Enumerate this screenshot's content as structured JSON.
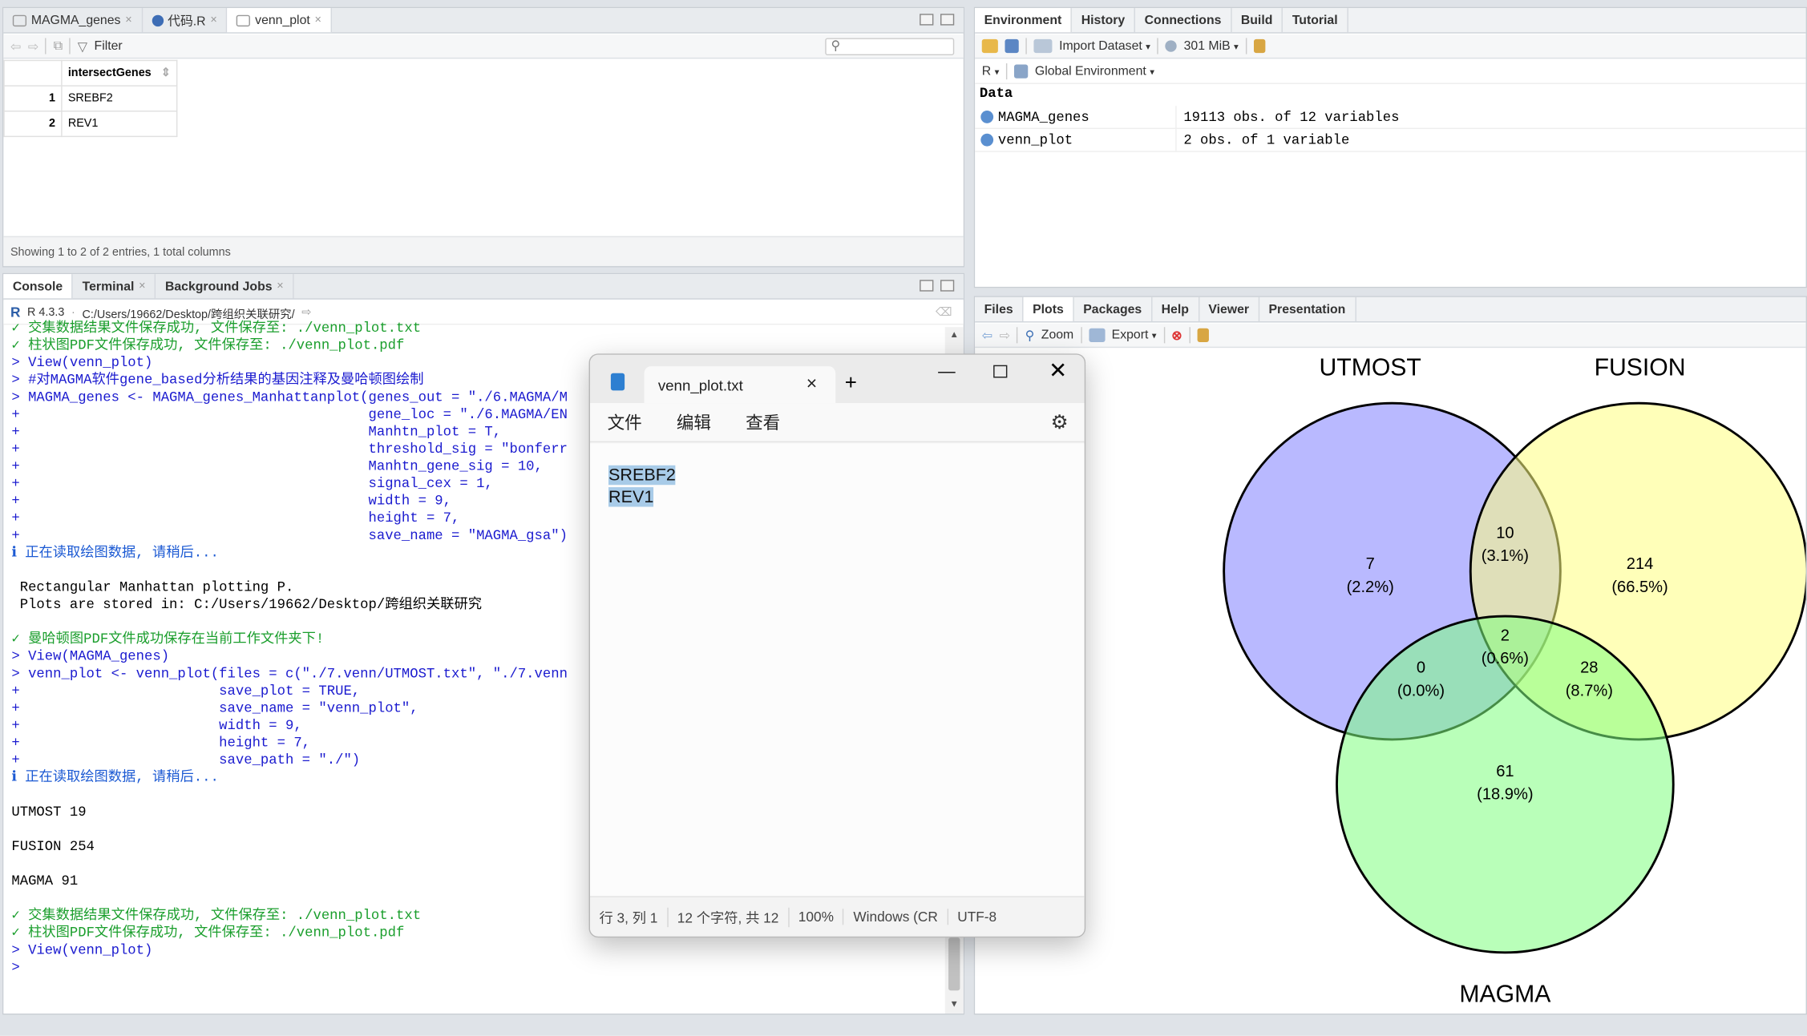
{
  "source_pane": {
    "tabs": [
      "MAGMA_genes",
      "代码.R",
      "venn_plot"
    ],
    "filter_label": "Filter",
    "column_header": "intersectGenes",
    "rows": [
      {
        "index": "1",
        "value": "SREBF2"
      },
      {
        "index": "2",
        "value": "REV1"
      }
    ],
    "status": "Showing 1 to 2 of 2 entries, 1 total columns"
  },
  "console_pane": {
    "tabs": [
      "Console",
      "Terminal",
      "Background Jobs"
    ],
    "r_version": "R 4.3.3",
    "path": "C:/Users/19662/Desktop/跨组织关联研究/",
    "lines": [
      {
        "t": "✓ 交集数据结果文件保存成功, 文件保存至: ./venn_plot.txt",
        "k": "ok"
      },
      {
        "t": "✓ 柱状图PDF文件保存成功, 文件保存至: ./venn_plot.pdf",
        "k": "ok"
      },
      {
        "t": "> View(venn_plot)",
        "k": "prompt"
      },
      {
        "t": "> #对MAGMA软件gene_based分析结果的基因注释及曼哈顿图绘制",
        "k": "prompt"
      },
      {
        "t": "> MAGMA_genes <- MAGMA_genes_Manhattanplot(genes_out = \"./6.MAGMA/M",
        "k": "prompt"
      },
      {
        "t": "+                                          gene_loc = \"./6.MAGMA/EN",
        "k": "prompt"
      },
      {
        "t": "+                                          Manhtn_plot = T,",
        "k": "prompt"
      },
      {
        "t": "+                                          threshold_sig = \"bonferr",
        "k": "prompt"
      },
      {
        "t": "+                                          Manhtn_gene_sig = 10,",
        "k": "prompt"
      },
      {
        "t": "+                                          signal_cex = 1,",
        "k": "prompt"
      },
      {
        "t": "+                                          width = 9,",
        "k": "prompt"
      },
      {
        "t": "+                                          height = 7,",
        "k": "prompt"
      },
      {
        "t": "+                                          save_name = \"MAGMA_gsa\")",
        "k": "prompt"
      },
      {
        "t": "ℹ 正在读取绘图数据, 请稍后...",
        "k": "info"
      },
      {
        "t": "",
        "k": "plain"
      },
      {
        "t": " Rectangular Manhattan plotting P.",
        "k": "plain"
      },
      {
        "t": " Plots are stored in: C:/Users/19662/Desktop/跨组织关联研究",
        "k": "plain"
      },
      {
        "t": "",
        "k": "plain"
      },
      {
        "t": "✓ 曼哈顿图PDF文件成功保存在当前工作文件夹下!",
        "k": "ok"
      },
      {
        "t": "> View(MAGMA_genes)",
        "k": "prompt"
      },
      {
        "t": "> venn_plot <- venn_plot(files = c(\"./7.venn/UTMOST.txt\", \"./7.venn",
        "k": "prompt"
      },
      {
        "t": "+                        save_plot = TRUE,",
        "k": "prompt"
      },
      {
        "t": "+                        save_name = \"venn_plot\",",
        "k": "prompt"
      },
      {
        "t": "+                        width = 9,",
        "k": "prompt"
      },
      {
        "t": "+                        height = 7,",
        "k": "prompt"
      },
      {
        "t": "+                        save_path = \"./\")",
        "k": "prompt"
      },
      {
        "t": "ℹ 正在读取绘图数据, 请稍后...",
        "k": "info"
      },
      {
        "t": "",
        "k": "plain"
      },
      {
        "t": "UTMOST 19",
        "k": "plain"
      },
      {
        "t": "",
        "k": "plain"
      },
      {
        "t": "FUSION 254",
        "k": "plain"
      },
      {
        "t": "",
        "k": "plain"
      },
      {
        "t": "MAGMA 91",
        "k": "plain"
      },
      {
        "t": "",
        "k": "plain"
      },
      {
        "t": "✓ 交集数据结果文件保存成功, 文件保存至: ./venn_plot.txt",
        "k": "ok"
      },
      {
        "t": "✓ 柱状图PDF文件保存成功, 文件保存至: ./venn_plot.pdf",
        "k": "ok"
      },
      {
        "t": "> View(venn_plot)",
        "k": "prompt"
      },
      {
        "t": "> ",
        "k": "prompt"
      }
    ]
  },
  "env_pane": {
    "tabs": [
      "Environment",
      "History",
      "Connections",
      "Build",
      "Tutorial"
    ],
    "import_label": "Import Dataset",
    "memory_label": "301 MiB",
    "lang_label": "R",
    "env_label": "Global Environment",
    "section": "Data",
    "items": [
      {
        "name": "MAGMA_genes",
        "value": "19113 obs. of 12 variables"
      },
      {
        "name": "venn_plot",
        "value": "2 obs. of 1 variable"
      }
    ]
  },
  "plots_pane": {
    "tabs": [
      "Files",
      "Plots",
      "Packages",
      "Help",
      "Viewer",
      "Presentation"
    ],
    "zoom_label": "Zoom",
    "export_label": "Export"
  },
  "chart_data": {
    "type": "venn",
    "sets": [
      "UTMOST",
      "FUSION",
      "MAGMA"
    ],
    "colors": {
      "UTMOST": "#7f7fff",
      "FUSION": "#ffff80",
      "MAGMA": "#80ff80"
    },
    "regions": [
      {
        "sets": [
          "UTMOST"
        ],
        "count": "7",
        "pct": "(2.2%)"
      },
      {
        "sets": [
          "FUSION"
        ],
        "count": "214",
        "pct": "(66.5%)"
      },
      {
        "sets": [
          "MAGMA"
        ],
        "count": "61",
        "pct": "(18.9%)"
      },
      {
        "sets": [
          "UTMOST",
          "FUSION"
        ],
        "count": "10",
        "pct": "(3.1%)"
      },
      {
        "sets": [
          "UTMOST",
          "MAGMA"
        ],
        "count": "0",
        "pct": "(0.0%)"
      },
      {
        "sets": [
          "FUSION",
          "MAGMA"
        ],
        "count": "28",
        "pct": "(8.7%)"
      },
      {
        "sets": [
          "UTMOST",
          "FUSION",
          "MAGMA"
        ],
        "count": "2",
        "pct": "(0.6%)"
      }
    ]
  },
  "notepad": {
    "tab_title": "venn_plot.txt",
    "menu": [
      "文件",
      "编辑",
      "查看"
    ],
    "content": [
      "SREBF2",
      "REV1"
    ],
    "status": [
      "行 3, 列 1",
      "12 个字符, 共 12",
      "100%",
      "Windows (CR",
      "UTF-8"
    ]
  }
}
